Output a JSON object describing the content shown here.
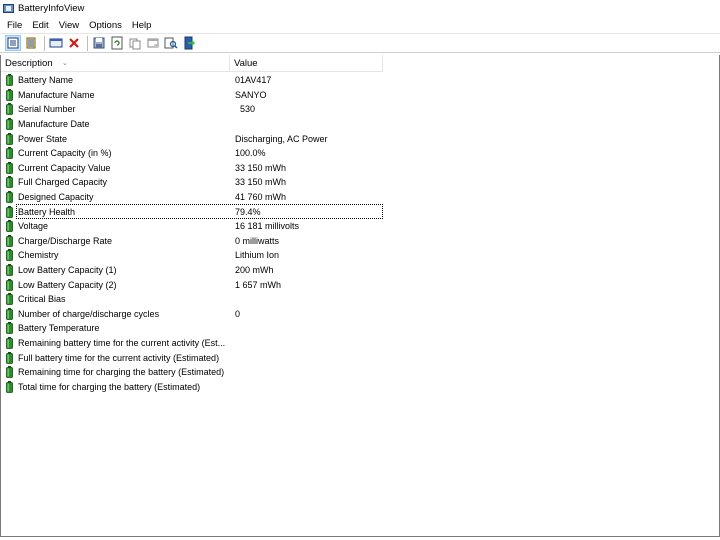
{
  "window": {
    "title": "BatteryInfoView"
  },
  "menu": [
    "File",
    "Edit",
    "View",
    "Options",
    "Help"
  ],
  "toolbar": [
    {
      "name": "report-view-icon",
      "active": true
    },
    {
      "name": "list-view-icon"
    },
    {
      "sep": true
    },
    {
      "name": "properties-icon"
    },
    {
      "name": "delete-icon"
    },
    {
      "sep": true
    },
    {
      "name": "save-icon"
    },
    {
      "name": "refresh-icon"
    },
    {
      "name": "copy-icon"
    },
    {
      "name": "properties-window-icon"
    },
    {
      "name": "find-icon"
    },
    {
      "name": "exit-icon"
    }
  ],
  "columns": {
    "description": "Description",
    "value": "Value",
    "sort_indicator": "⌄"
  },
  "rows": [
    {
      "description": "Battery Name",
      "value": "01AV417"
    },
    {
      "description": "Manufacture Name",
      "value": "SANYO"
    },
    {
      "description": "Serial Number",
      "value": "  530"
    },
    {
      "description": "Manufacture Date",
      "value": ""
    },
    {
      "description": "Power State",
      "value": "Discharging, AC Power"
    },
    {
      "description": "Current Capacity (in %)",
      "value": "100.0%"
    },
    {
      "description": "Current Capacity Value",
      "value": "33 150 mWh"
    },
    {
      "description": "Full Charged Capacity",
      "value": "33 150 mWh"
    },
    {
      "description": "Designed Capacity",
      "value": "41 760 mWh"
    },
    {
      "description": "Battery Health",
      "value": "79.4%",
      "focused": true
    },
    {
      "description": "Voltage",
      "value": "16 181 millivolts"
    },
    {
      "description": "Charge/Discharge Rate",
      "value": "0 milliwatts"
    },
    {
      "description": "Chemistry",
      "value": "Lithium Ion"
    },
    {
      "description": "Low Battery Capacity (1)",
      "value": "200 mWh"
    },
    {
      "description": "Low Battery Capacity (2)",
      "value": "1 657 mWh"
    },
    {
      "description": "Critical Bias",
      "value": ""
    },
    {
      "description": "Number of charge/discharge cycles",
      "value": "0"
    },
    {
      "description": "Battery Temperature",
      "value": ""
    },
    {
      "description": "Remaining battery time for the current activity (Est...",
      "value": ""
    },
    {
      "description": "Full battery time for the current activity (Estimated)",
      "value": ""
    },
    {
      "description": "Remaining time for charging the battery (Estimated)",
      "value": ""
    },
    {
      "description": "Total  time for charging the battery (Estimated)",
      "value": ""
    }
  ],
  "colors": {
    "battery_green": "#2e8b2e",
    "battery_dark": "#0f4f0f",
    "delete_red": "#d11a1a"
  }
}
